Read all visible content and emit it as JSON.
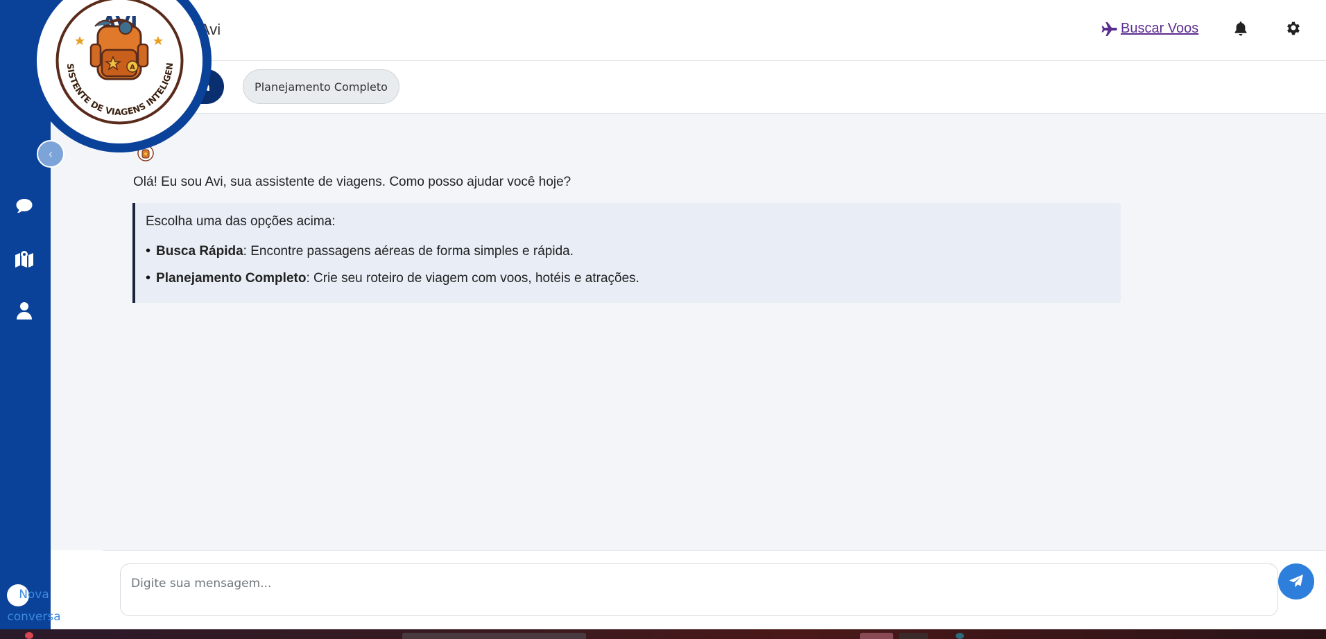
{
  "brand": {
    "logo_text": "AVI",
    "logo_ring_text": "ASSISTENTE DE VIAGENS INTELIGENTE"
  },
  "header": {
    "title": "Avi",
    "flights_link": "Buscar Voos"
  },
  "sidebar": {
    "items": [
      {
        "icon": "chat-icon"
      },
      {
        "icon": "map-icon"
      },
      {
        "icon": "user-icon"
      }
    ],
    "new_chat_label": "Nova conversa"
  },
  "modes": {
    "quick": "Busca Rápida",
    "quick_visible": "a",
    "full": "Planejamento Completo"
  },
  "chat": {
    "greeting": "Olá! Eu sou Avi, sua assistente de viagens. Como posso ajudar você hoje?",
    "box_intro": "Escolha uma das opções acima:",
    "options": [
      {
        "title": "Busca Rápida",
        "desc": ": Encontre passagens aéreas de forma simples e rápida."
      },
      {
        "title": "Planejamento Completo",
        "desc": ": Crie seu roteiro de viagem com voos, hotéis e atrações."
      }
    ]
  },
  "input": {
    "placeholder": "Digite sua mensagem..."
  },
  "colors": {
    "sidebar": "#0a4199",
    "accent": "#2e7fdc",
    "link": "#5b2d90"
  }
}
